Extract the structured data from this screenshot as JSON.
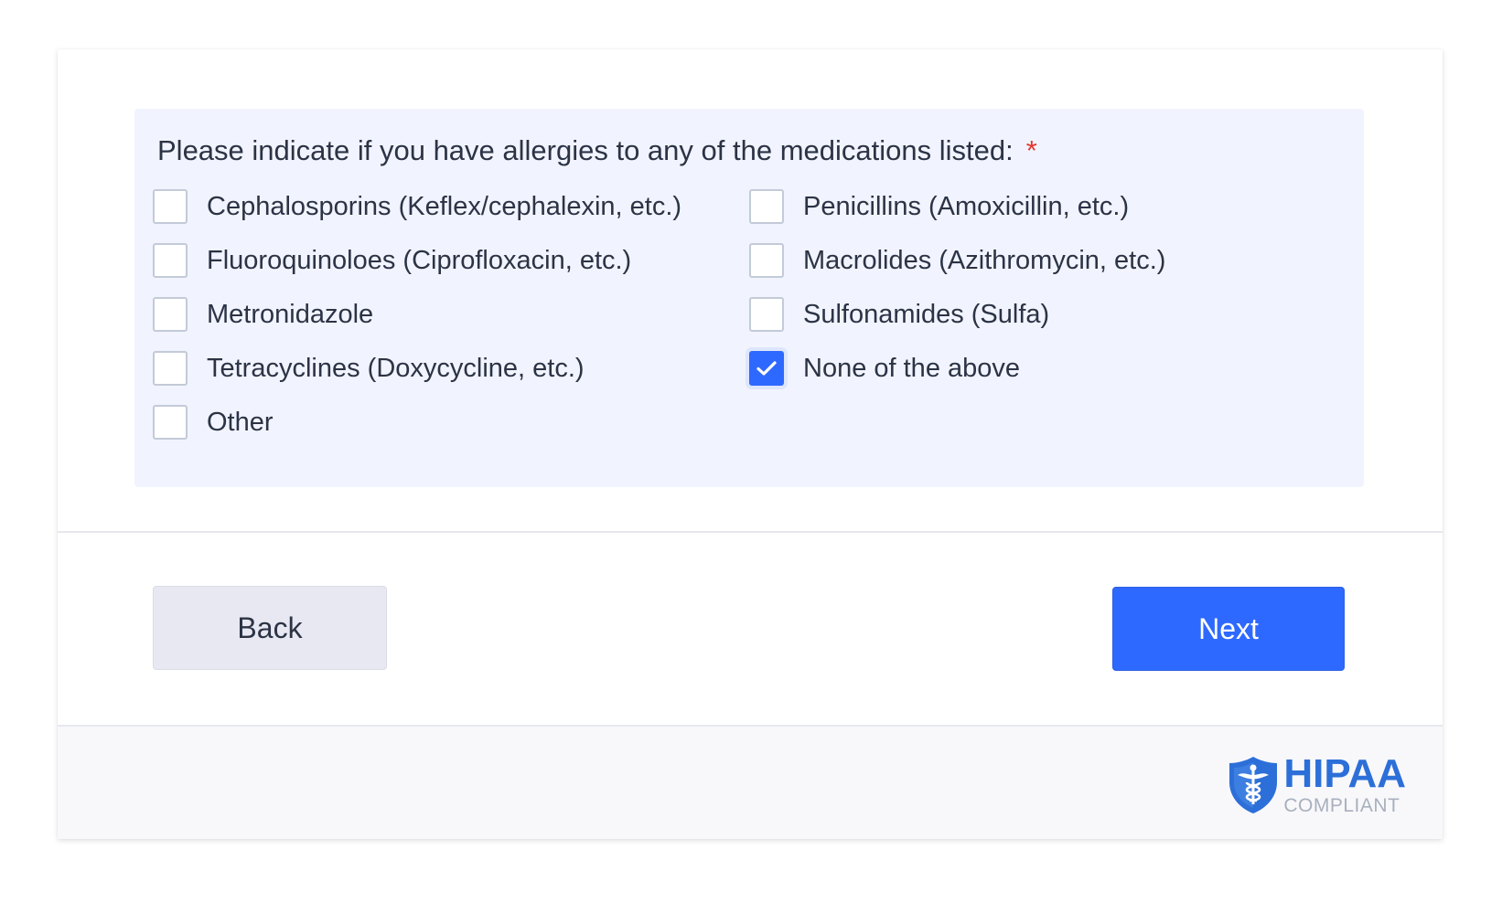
{
  "question": {
    "label": "Please indicate if you have allergies to any of the medications listed:",
    "required_mark": "*",
    "options_left": [
      {
        "label": "Cephalosporins (Keflex/cephalexin, etc.)",
        "checked": false
      },
      {
        "label": "Fluoroquinoloes (Ciprofloxacin, etc.)",
        "checked": false
      },
      {
        "label": "Metronidazole",
        "checked": false
      },
      {
        "label": "Tetracyclines (Doxycycline, etc.)",
        "checked": false
      },
      {
        "label": "Other",
        "checked": false
      }
    ],
    "options_right": [
      {
        "label": "Penicillins (Amoxicillin, etc.)",
        "checked": false
      },
      {
        "label": "Macrolides (Azithromycin, etc.)",
        "checked": false
      },
      {
        "label": "Sulfonamides (Sulfa)",
        "checked": false
      },
      {
        "label": "None of the above",
        "checked": true
      }
    ]
  },
  "navigation": {
    "back_label": "Back",
    "next_label": "Next"
  },
  "footer": {
    "badge_title": "HIPAA",
    "badge_subtitle": "COMPLIANT",
    "badge_icon": "caduceus-shield-icon"
  },
  "colors": {
    "accent": "#2e69ff",
    "required": "#e4362f",
    "question_bg": "#f1f4fe",
    "hipaa_blue": "#2c6fd8"
  }
}
